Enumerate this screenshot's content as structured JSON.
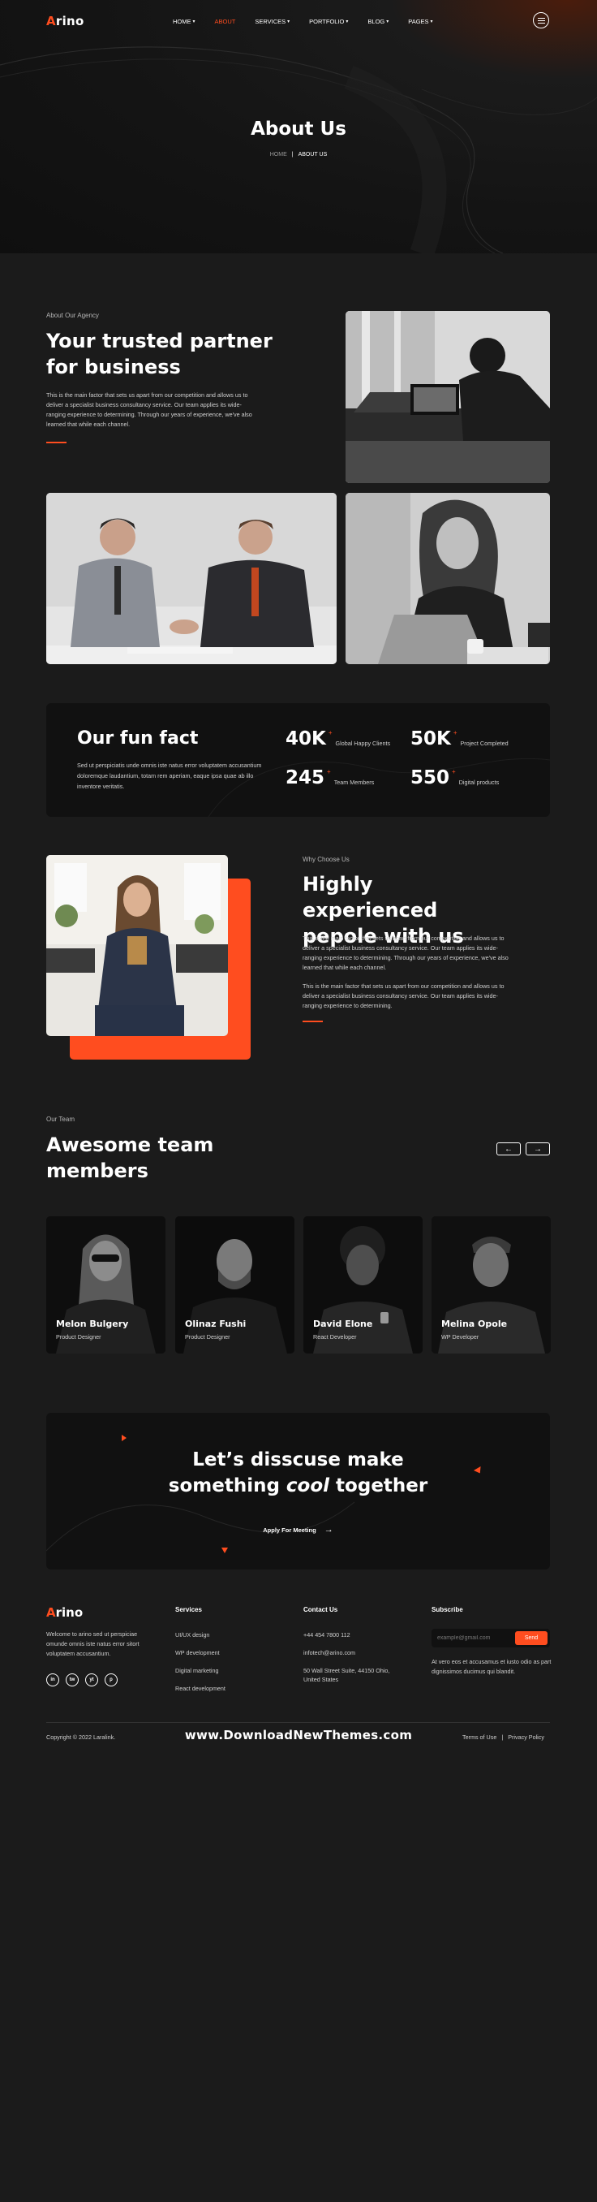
{
  "nav": {
    "logo_a": "A",
    "logo_rest": "rino",
    "items": [
      {
        "label": "HOME"
      },
      {
        "label": "ABOUT"
      },
      {
        "label": "SERVICES"
      },
      {
        "label": "PORTFOLIO"
      },
      {
        "label": "BLOG"
      },
      {
        "label": "PAGES"
      }
    ],
    "active_item": "ABOUT"
  },
  "hero": {
    "title": "About Us",
    "breadcrumb_home": "HOME",
    "breadcrumb_sep": "|",
    "breadcrumb_current": "ABOUT US"
  },
  "about": {
    "label": "About Our Agency",
    "title": "Your trusted partner for business",
    "text": "This is the main factor that sets us apart from our competition and allows us to deliver a specialist business consultancy service. Our team applies its wide-ranging experience to determining. Through our years of experience, we've also learned that while each channel."
  },
  "fact": {
    "title": "Our fun fact",
    "text": "Sed ut perspiciatis unde omnis iste natus error voluptatem accusantium doloremque laudantium, totam rem aperiam, eaque ipsa quae ab illo inventore veritatis.",
    "stats": [
      {
        "value": "40K",
        "plus": "+",
        "label": "Global Happy Clients"
      },
      {
        "value": "50K",
        "plus": "+",
        "label": "Project Completed"
      },
      {
        "value": "245",
        "plus": "+",
        "label": "Team Members"
      },
      {
        "value": "550",
        "plus": "+",
        "label": "Digital products"
      }
    ]
  },
  "why": {
    "label": "Why Choose Us",
    "title": "Highly experienced pepole with us",
    "text1": "This is the main factor that sets us apart from our competition and allows us to deliver a specialist business consultancy service. Our team applies its wide-ranging experience to determining. Through our years of experience, we've also learned that while each channel.",
    "text2": "This is the main factor that sets us apart from our competition and allows us to deliver a specialist business consultancy service. Our team applies its wide-ranging experience to determining."
  },
  "team": {
    "label": "Our Team",
    "title": "Awesome team members",
    "prev_icon": "arrow-left-icon",
    "next_icon": "arrow-right-icon",
    "members": [
      {
        "name": "Melon Bulgery",
        "role": "Product Designer"
      },
      {
        "name": "Olinaz Fushi",
        "role": "Product Designer"
      },
      {
        "name": "David Elone",
        "role": "React Developer"
      },
      {
        "name": "Melina Opole",
        "role": "WP Developer"
      }
    ]
  },
  "cta": {
    "line1": "Let’s disscuse make",
    "line2_a": "something ",
    "line2_cool": "cool",
    "line2_b": " together",
    "button": "Apply For Meeting"
  },
  "footer": {
    "logo_a": "A",
    "logo_rest": "rino",
    "desc": "Welcome to arino sed ut perspiciae omunde omnis iste natus error sitort voluptatem accusantium.",
    "social": [
      "in",
      "tw",
      "yt",
      "p"
    ],
    "services_title": "Services",
    "services": [
      "UI/UX design",
      "WP development",
      "Digital marketing",
      "React development"
    ],
    "contact_title": "Contact Us",
    "phone": "+44 454 7800 112",
    "email": "infotech@arino.com",
    "address": "50 Wall Street Suite, 44150 Ohio, United States",
    "subscribe_title": "Subscribe",
    "email_placeholder": "example@gmail.com",
    "send": "Send",
    "subscribe_text": "At vero eos et accusamus et iusto odio as part dignissimos ducimus qui blandit.",
    "copyright": "Copyright © 2022 Laralink.",
    "watermark": "www.DownloadNewThemes.com",
    "terms": "Terms of Use",
    "privacy": "Privacy Policy"
  },
  "colors": {
    "accent": "#ff4d1f",
    "bg": "#1b1b1b",
    "card": "#111111"
  }
}
